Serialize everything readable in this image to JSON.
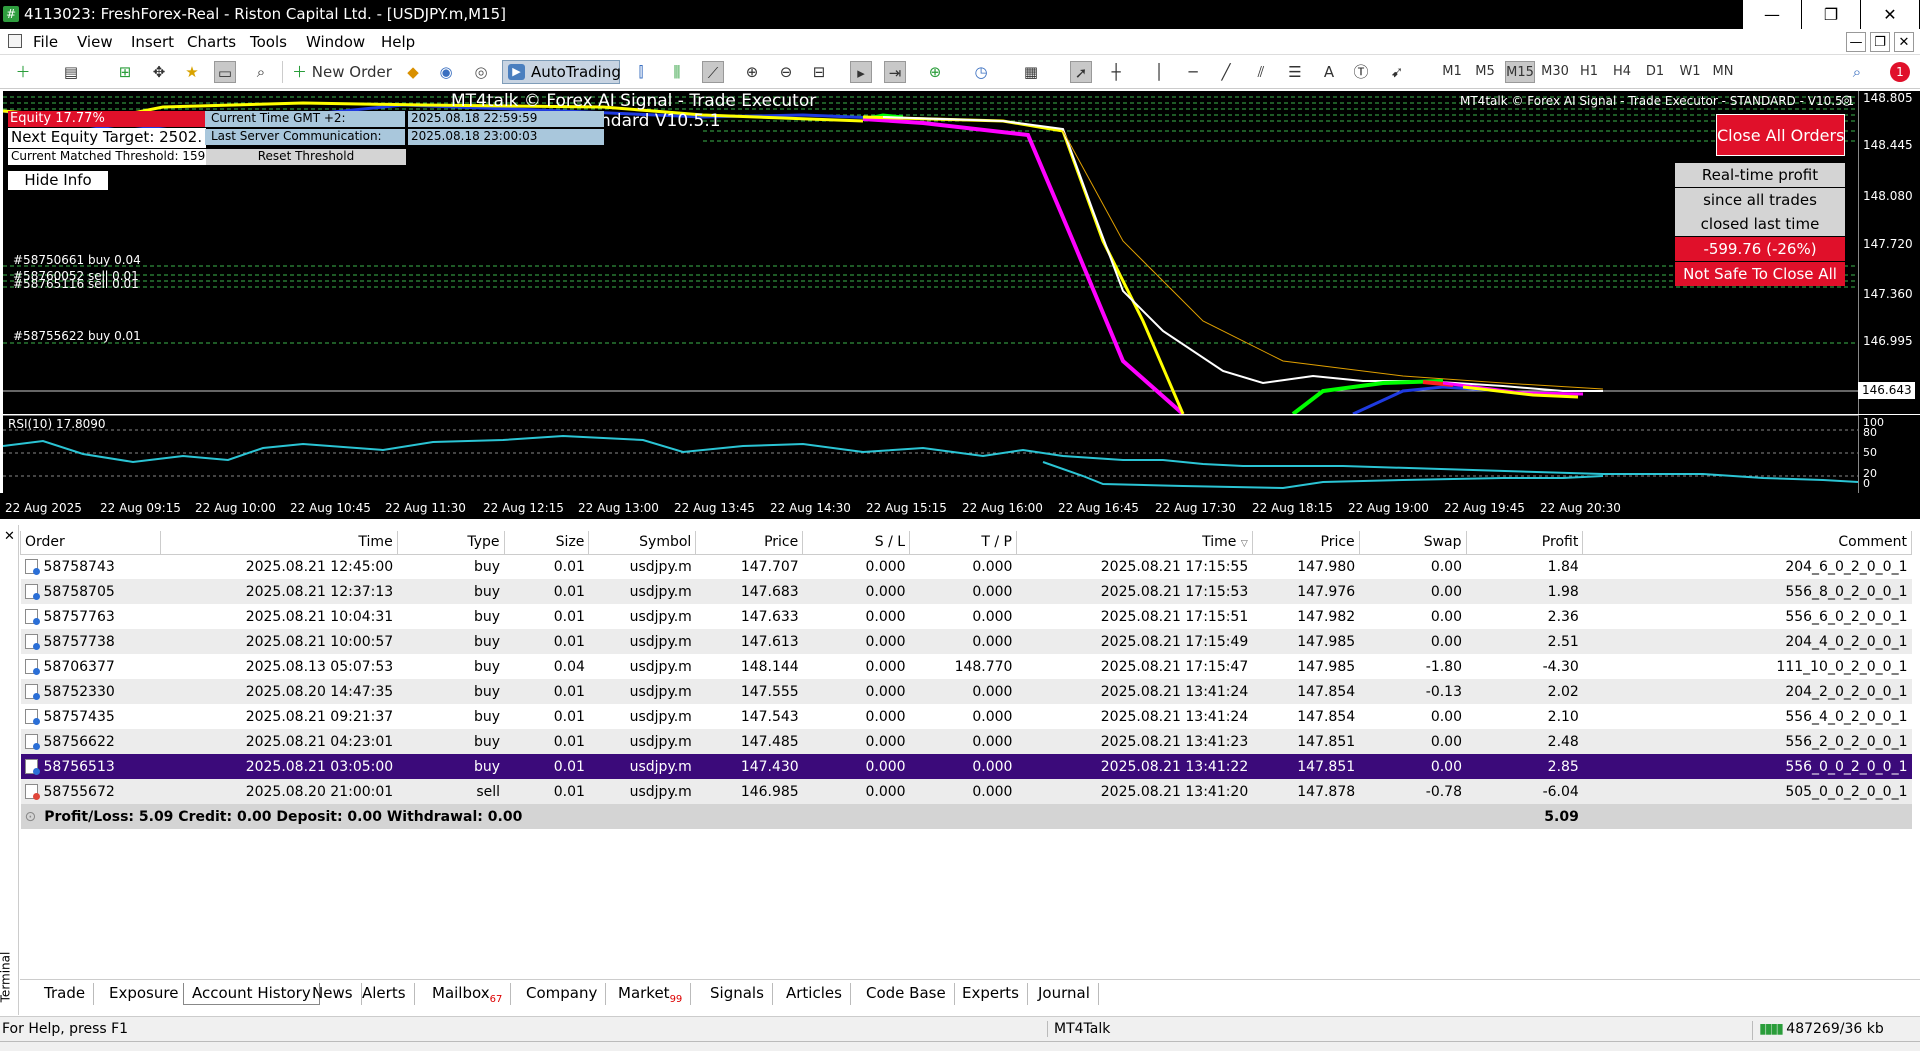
{
  "window": {
    "title": "4113023: FreshForex-Real - Riston Capital Ltd. - [USDJPY.m,M15]",
    "controls": [
      "—",
      "❐",
      "✕"
    ]
  },
  "menu": [
    "File",
    "View",
    "Insert",
    "Charts",
    "Tools",
    "Window",
    "Help"
  ],
  "toolbar": {
    "new_order": "New Order",
    "autotrading": "AutoTrading",
    "timeframes": [
      "M1",
      "M5",
      "M15",
      "M30",
      "H1",
      "H4",
      "D1",
      "W1",
      "MN"
    ],
    "active_timeframe": "M15",
    "notification_count": "1"
  },
  "chart": {
    "header_left": "MT4talk © Forex AI Signal - Trade Executor",
    "header_left2": "ndard V10.5.1",
    "header_right": "MT4talk © Forex AI Signal - Trade Executor - STANDARD - V10.5.1",
    "equity_label": "Equity 17.77%",
    "next_equity_target": "Next Equity Target: 2502.",
    "current_time_label": "Current Time GMT +2:",
    "current_time_value": "2025.08.18 22:59:59",
    "last_server_label": "Last Server Communication:",
    "last_server_value": "2025.08.18 23:00:03",
    "matched_threshold": "Current Matched Threshold: 159.",
    "reset_threshold": "Reset Threshold",
    "hide_info": "Hide Info",
    "close_all_orders": "Close All Orders",
    "realtime_profit_1": "Real-time profit",
    "realtime_profit_2": "since all trades",
    "realtime_profit_3": "closed last time",
    "profit_value": "-599.76 (-26%)",
    "not_safe": "Not Safe To Close All",
    "order_lines": [
      "#58750661 buy 0.04",
      "#58760052 sell 0.01",
      "#58765116 sell 0.01",
      "#58755622 buy 0.01"
    ],
    "price_levels": [
      "148.805",
      "148.445",
      "148.080",
      "147.720",
      "147.360",
      "146.995"
    ],
    "current_price": "146.643",
    "rsi_label": "RSI(10) 17.8090",
    "rsi_levels": [
      "100",
      "80",
      "50",
      "20",
      "0"
    ],
    "time_labels": [
      "22 Aug 2025",
      "22 Aug 09:15",
      "22 Aug 10:00",
      "22 Aug 10:45",
      "22 Aug 11:30",
      "22 Aug 12:15",
      "22 Aug 13:00",
      "22 Aug 13:45",
      "22 Aug 14:30",
      "22 Aug 15:15",
      "22 Aug 16:00",
      "22 Aug 16:45",
      "22 Aug 17:30",
      "22 Aug 18:15",
      "22 Aug 19:00",
      "22 Aug 19:45",
      "22 Aug 20:30"
    ]
  },
  "history": {
    "columns": [
      "Order",
      "Time",
      "Type",
      "Size",
      "Symbol",
      "Price",
      "S / L",
      "T / P",
      "Time",
      "Price",
      "Swap",
      "Profit",
      "Comment"
    ],
    "rows": [
      [
        "58758743",
        "2025.08.21 12:45:00",
        "buy",
        "0.01",
        "usdjpy.m",
        "147.707",
        "0.000",
        "0.000",
        "2025.08.21 17:15:55",
        "147.980",
        "0.00",
        "1.84",
        "204_6_0_2_0_0_1"
      ],
      [
        "58758705",
        "2025.08.21 12:37:13",
        "buy",
        "0.01",
        "usdjpy.m",
        "147.683",
        "0.000",
        "0.000",
        "2025.08.21 17:15:53",
        "147.976",
        "0.00",
        "1.98",
        "556_8_0_2_0_0_1"
      ],
      [
        "58757763",
        "2025.08.21 10:04:31",
        "buy",
        "0.01",
        "usdjpy.m",
        "147.633",
        "0.000",
        "0.000",
        "2025.08.21 17:15:51",
        "147.982",
        "0.00",
        "2.36",
        "556_6_0_2_0_0_1"
      ],
      [
        "58757738",
        "2025.08.21 10:00:57",
        "buy",
        "0.01",
        "usdjpy.m",
        "147.613",
        "0.000",
        "0.000",
        "2025.08.21 17:15:49",
        "147.985",
        "0.00",
        "2.51",
        "204_4_0_2_0_0_1"
      ],
      [
        "58706377",
        "2025.08.13 05:07:53",
        "buy",
        "0.04",
        "usdjpy.m",
        "148.144",
        "0.000",
        "148.770",
        "2025.08.21 17:15:47",
        "147.985",
        "-1.80",
        "-4.30",
        "111_10_0_2_0_0_1"
      ],
      [
        "58752330",
        "2025.08.20 14:47:35",
        "buy",
        "0.01",
        "usdjpy.m",
        "147.555",
        "0.000",
        "0.000",
        "2025.08.21 13:41:24",
        "147.854",
        "-0.13",
        "2.02",
        "204_2_0_2_0_0_1"
      ],
      [
        "58757435",
        "2025.08.21 09:21:37",
        "buy",
        "0.01",
        "usdjpy.m",
        "147.543",
        "0.000",
        "0.000",
        "2025.08.21 13:41:24",
        "147.854",
        "0.00",
        "2.10",
        "556_4_0_2_0_0_1"
      ],
      [
        "58756622",
        "2025.08.21 04:23:01",
        "buy",
        "0.01",
        "usdjpy.m",
        "147.485",
        "0.000",
        "0.000",
        "2025.08.21 13:41:23",
        "147.851",
        "0.00",
        "2.48",
        "556_2_0_2_0_0_1"
      ],
      [
        "58756513",
        "2025.08.21 03:05:00",
        "buy",
        "0.01",
        "usdjpy.m",
        "147.430",
        "0.000",
        "0.000",
        "2025.08.21 13:41:22",
        "147.851",
        "0.00",
        "2.85",
        "556_0_0_2_0_0_1"
      ],
      [
        "58755672",
        "2025.08.20 21:00:01",
        "sell",
        "0.01",
        "usdjpy.m",
        "146.985",
        "0.000",
        "0.000",
        "2025.08.21 13:41:20",
        "147.878",
        "-0.78",
        "-6.04",
        "505_0_0_2_0_0_1"
      ]
    ],
    "selected_row": 8,
    "summary": "Profit/Loss: 5.09  Credit: 0.00  Deposit: 0.00  Withdrawal: 0.00",
    "summary_total": "5.09"
  },
  "terminal_label": "Terminal",
  "tabs": [
    {
      "label": "Trade",
      "badge": ""
    },
    {
      "label": "Exposure",
      "badge": ""
    },
    {
      "label": "Account History",
      "badge": ""
    },
    {
      "label": "News",
      "badge": ""
    },
    {
      "label": "Alerts",
      "badge": ""
    },
    {
      "label": "Mailbox",
      "badge": "67"
    },
    {
      "label": "Company",
      "badge": ""
    },
    {
      "label": "Market",
      "badge": "99"
    },
    {
      "label": "Signals",
      "badge": ""
    },
    {
      "label": "Articles",
      "badge": ""
    },
    {
      "label": "Code Base",
      "badge": ""
    },
    {
      "label": "Experts",
      "badge": ""
    },
    {
      "label": "Journal",
      "badge": ""
    }
  ],
  "active_tab": "Account History",
  "statusbar": {
    "help": "For Help, press F1",
    "profile": "MT4Talk",
    "traffic": "487269/36 kb"
  },
  "colors": {
    "chart_bg": "#000000",
    "selected_row": "#3b0a7a",
    "alert_red": "#e0102a",
    "ma_yellow": "#ffff00",
    "ma_magenta": "#ff00ff",
    "rsi_line": "#2bc4d4"
  }
}
